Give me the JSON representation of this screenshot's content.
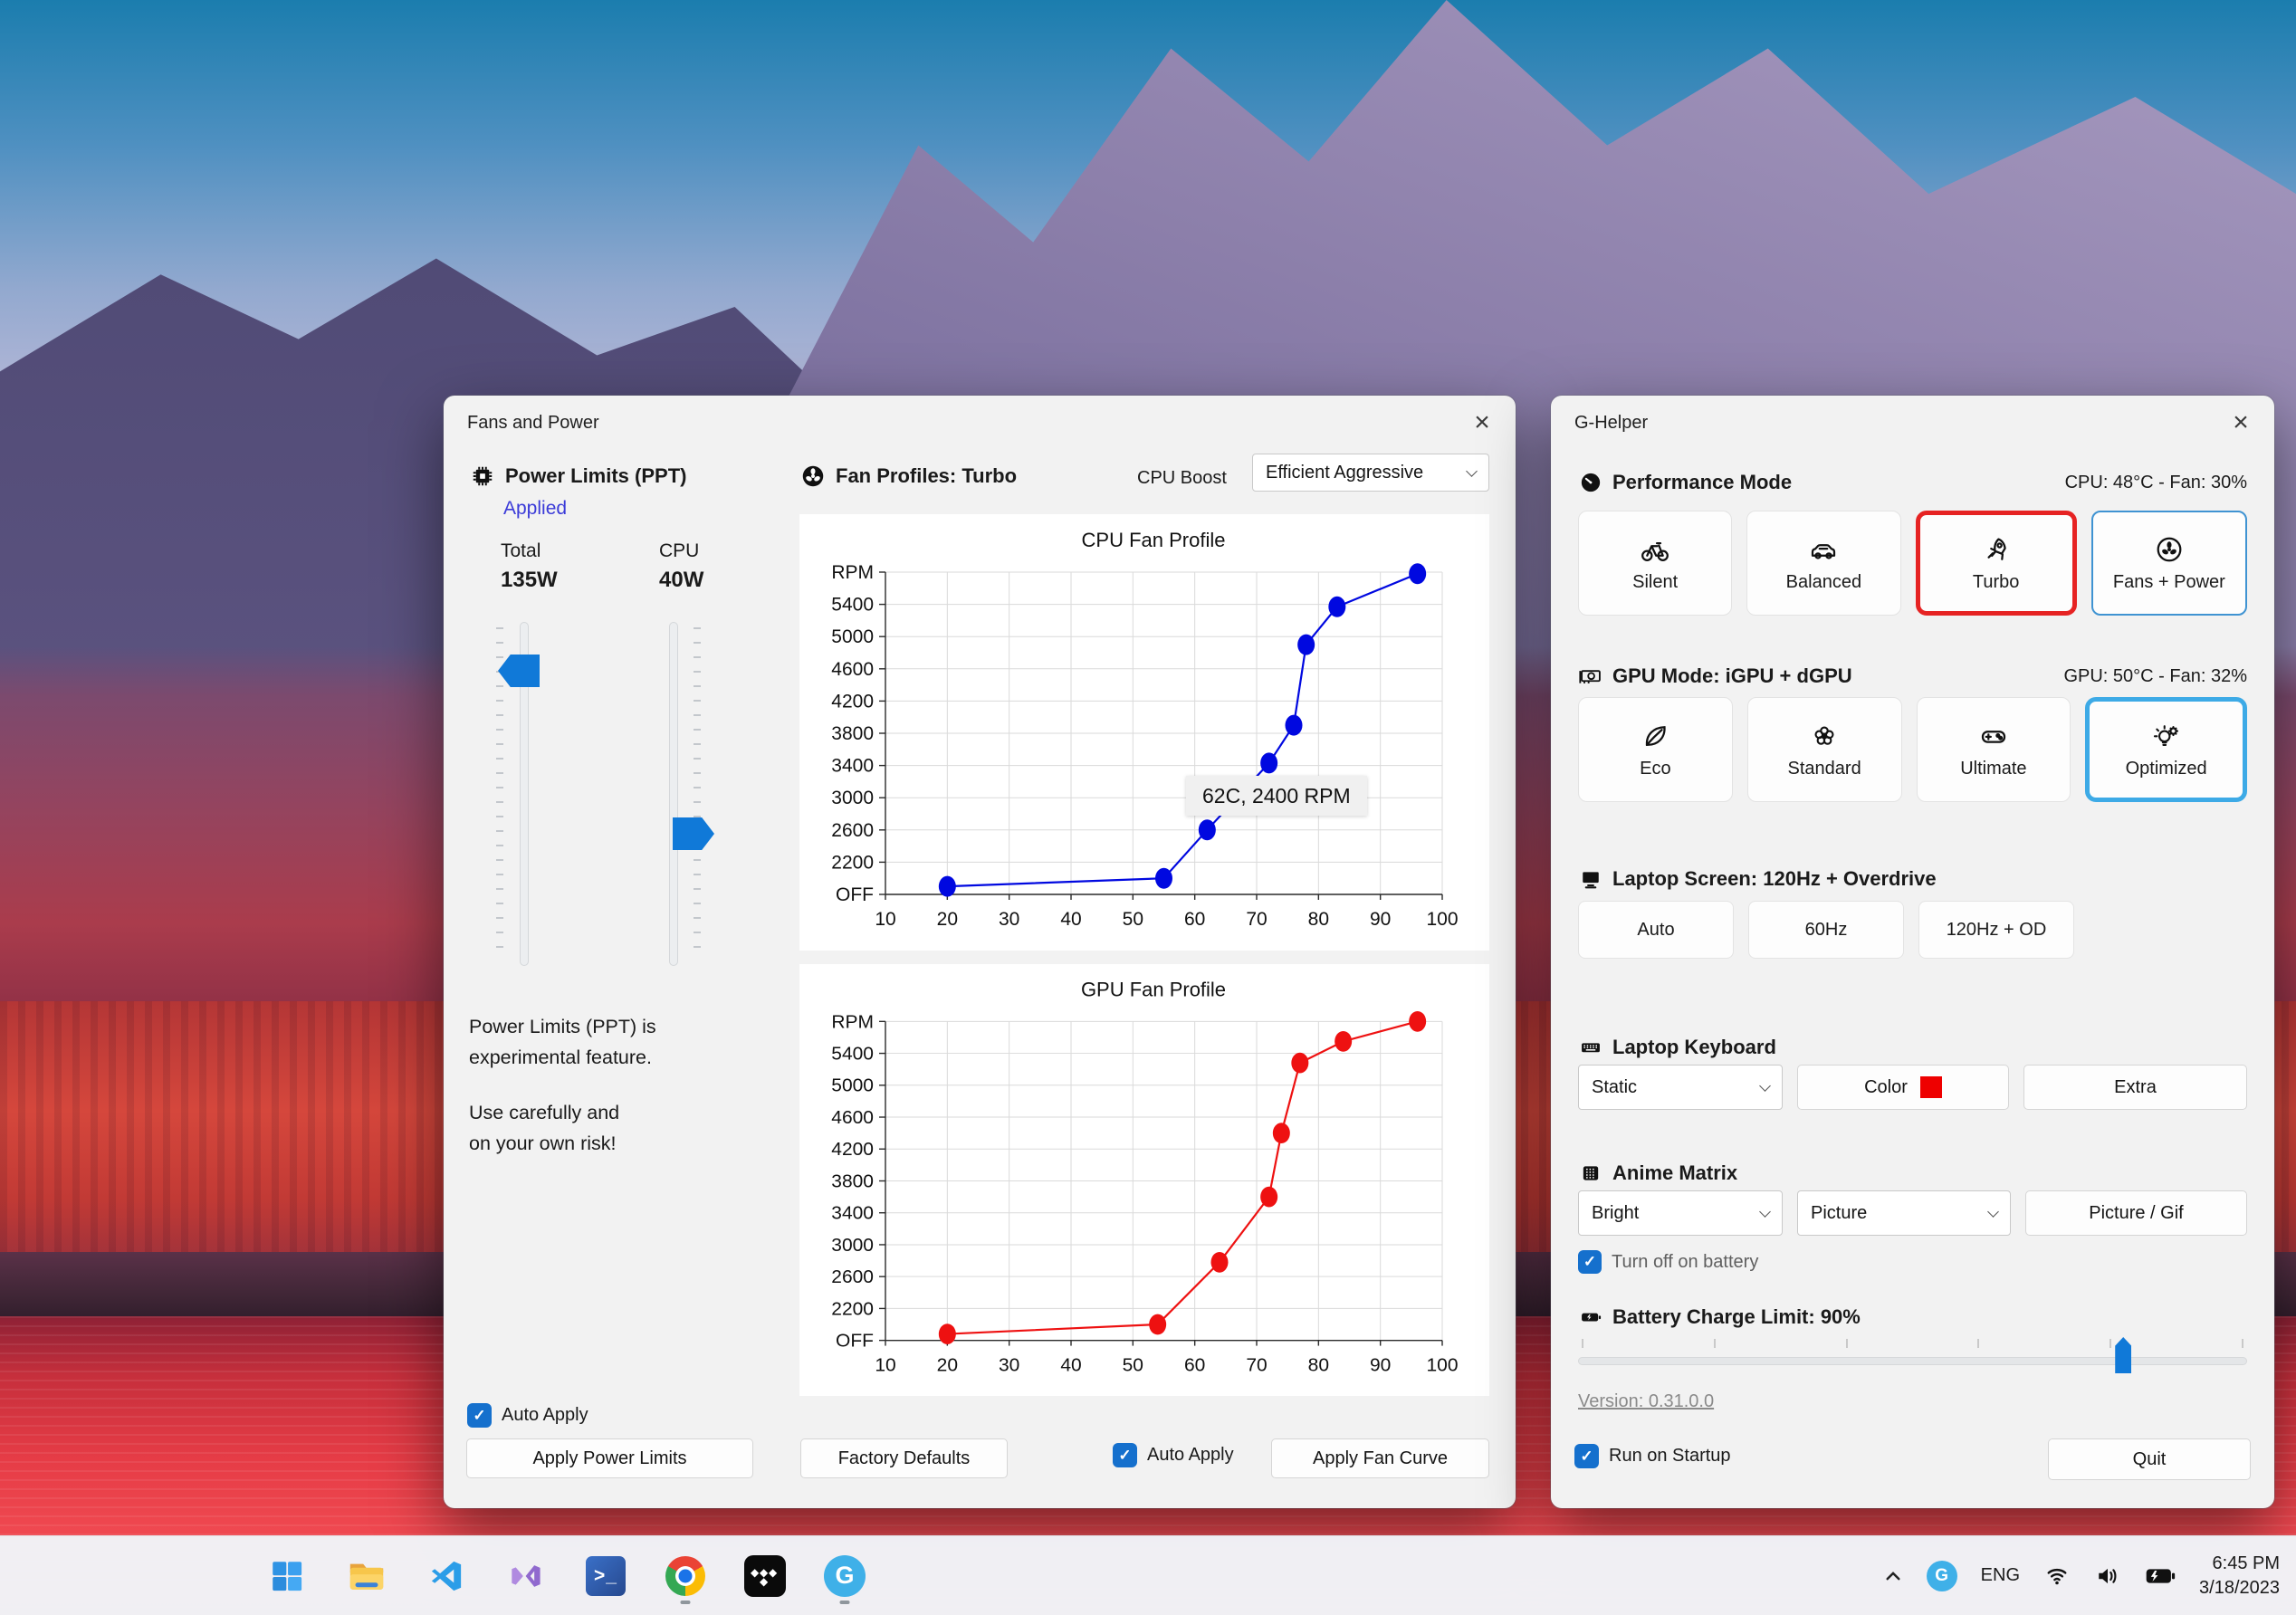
{
  "colors": {
    "checkbox_blue": "#1570cd",
    "slider_blue": "#1079d8",
    "applied_blue": "#3b3bd8",
    "turbo_selected_border": "#e62323",
    "optimized_selected_border": "#3daae6",
    "keyboard_color_swatch": "#ee0000",
    "cpu_curve": "#0008e0",
    "gpu_curve": "#ee1111"
  },
  "fans_window": {
    "title": "Fans and Power",
    "close": "×",
    "power": {
      "header": "Power Limits (PPT)",
      "status": "Applied",
      "total_label": "Total",
      "total_value": "135W",
      "cpu_label": "CPU",
      "cpu_value": "40W",
      "warning_lines": [
        "Power Limits (PPT) is",
        "experimental feature.",
        "Use carefully and",
        "on your own risk!"
      ],
      "auto_apply_label": "Auto Apply",
      "apply_button": "Apply Power Limits"
    },
    "profiles": {
      "header": "Fan Profiles: Turbo",
      "cpu_boost_label": "CPU Boost",
      "cpu_boost_value": "Efficient Aggressive",
      "tooltip": "62C, 2400 RPM",
      "factory_button": "Factory Defaults",
      "auto_apply_label": "Auto Apply",
      "apply_button": "Apply Fan Curve"
    }
  },
  "chart_data": [
    {
      "type": "line",
      "title": "CPU Fan Profile",
      "color": "#0008e0",
      "x": [
        20,
        55,
        62,
        72,
        76,
        78,
        83,
        96
      ],
      "y": [
        1900,
        2000,
        2600,
        3430,
        3900,
        4900,
        5370,
        5780
      ],
      "xlim": [
        10,
        100
      ],
      "ylim": [
        1800,
        5800
      ],
      "x_ticks": [
        10,
        20,
        30,
        40,
        50,
        60,
        70,
        80,
        90,
        100
      ],
      "y_tick_labels": [
        "OFF",
        "2200",
        "2600",
        "3000",
        "3400",
        "3800",
        "4200",
        "4600",
        "5000",
        "5400",
        "RPM"
      ],
      "ylabel": "RPM",
      "xlabel": "",
      "grid": true,
      "legend": "none"
    },
    {
      "type": "line",
      "title": "GPU Fan Profile",
      "color": "#ee1111",
      "x": [
        20,
        54,
        64,
        72,
        74,
        77,
        84,
        96
      ],
      "y": [
        1880,
        2000,
        2780,
        3600,
        4400,
        5280,
        5550,
        5800
      ],
      "xlim": [
        10,
        100
      ],
      "ylim": [
        1800,
        5800
      ],
      "x_ticks": [
        10,
        20,
        30,
        40,
        50,
        60,
        70,
        80,
        90,
        100
      ],
      "y_tick_labels": [
        "OFF",
        "2200",
        "2600",
        "3000",
        "3400",
        "3800",
        "4200",
        "4600",
        "5000",
        "5400",
        "RPM"
      ],
      "ylabel": "RPM",
      "xlabel": "",
      "grid": true,
      "legend": "none"
    }
  ],
  "ghelper": {
    "title": "G-Helper",
    "close": "×",
    "performance": {
      "header": "Performance Mode",
      "status": "CPU: 48°C -  Fan: 30%",
      "buttons": [
        {
          "label": "Silent",
          "icon": "bicycle-icon"
        },
        {
          "label": "Balanced",
          "icon": "car-icon"
        },
        {
          "label": "Turbo",
          "icon": "rocket-icon",
          "selected": "red"
        },
        {
          "label": "Fans + Power",
          "icon": "fan-icon",
          "selected": "blue-thin"
        }
      ]
    },
    "gpu": {
      "header": "GPU Mode: iGPU + dGPU",
      "status": "GPU: 50°C -  Fan: 32%",
      "buttons": [
        {
          "label": "Eco",
          "icon": "leaf-icon"
        },
        {
          "label": "Standard",
          "icon": "flower-icon"
        },
        {
          "label": "Ultimate",
          "icon": "gamepad-icon"
        },
        {
          "label": "Optimized",
          "icon": "bulb-gear-icon",
          "selected": "blue-thick"
        }
      ]
    },
    "screen": {
      "header": "Laptop Screen: 120Hz + Overdrive",
      "buttons": [
        {
          "label": "Auto",
          "selected": "gray"
        },
        {
          "label": "60Hz"
        },
        {
          "label": "120Hz + OD"
        }
      ]
    },
    "keyboard": {
      "header": "Laptop Keyboard",
      "mode_value": "Static",
      "color_label": "Color",
      "extra_label": "Extra"
    },
    "anime": {
      "header": "Anime Matrix",
      "brightness_value": "Bright",
      "mode_value": "Picture",
      "picture_button": "Picture / Gif",
      "battery_checkbox": "Turn off on battery"
    },
    "battery": {
      "header": "Battery Charge Limit: 90%",
      "percent": 90
    },
    "version": "Version: 0.31.0.0",
    "startup_checkbox": "Run on Startup",
    "quit": "Quit"
  },
  "taskbar": {
    "apps": [
      "start",
      "file-explorer",
      "vscode",
      "visual-studio",
      "terminal",
      "chrome",
      "tidal",
      "g-helper"
    ],
    "tray": {
      "language": "ENG",
      "time": "6:45 PM",
      "date": "3/18/2023"
    }
  }
}
